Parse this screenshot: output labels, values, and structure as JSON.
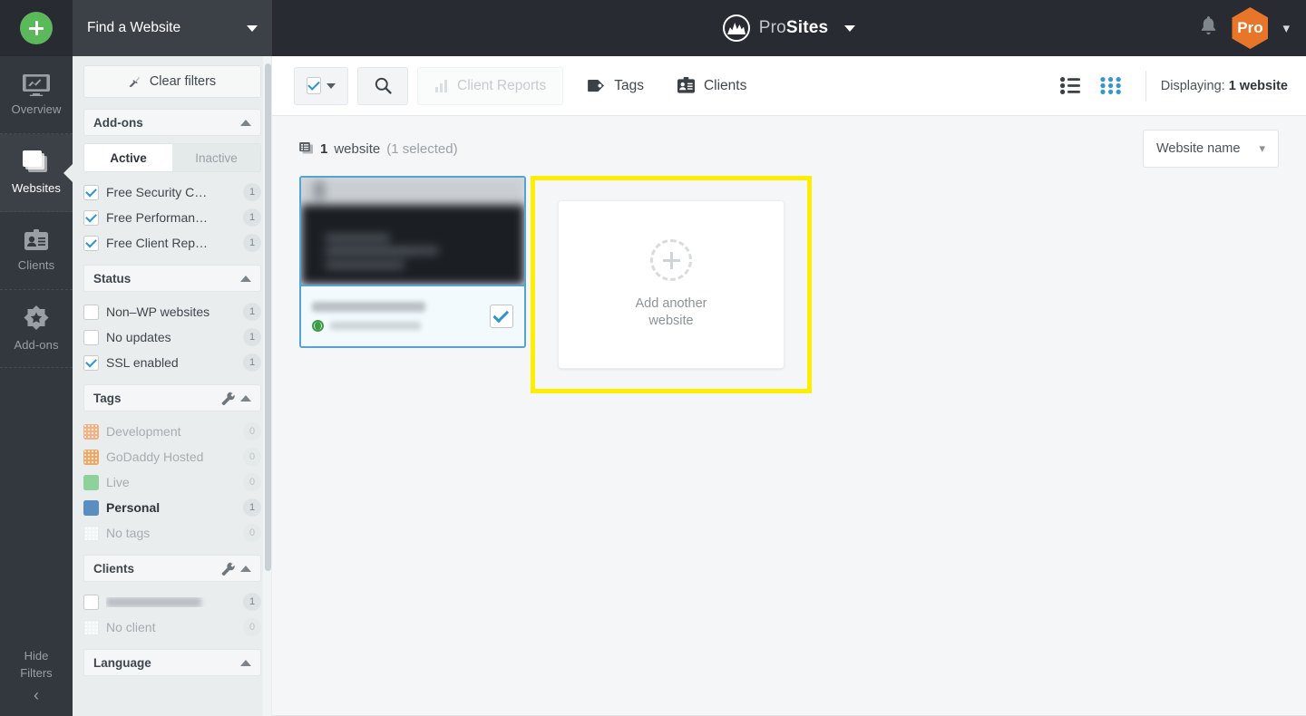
{
  "rail": {
    "add_button_tooltip": "+",
    "items": [
      {
        "label": "Overview",
        "icon": "monitor-chart-icon",
        "active": false
      },
      {
        "label": "Websites",
        "icon": "websites-stack-icon",
        "active": true
      },
      {
        "label": "Clients",
        "icon": "client-badge-icon",
        "active": false
      },
      {
        "label": "Add-ons",
        "icon": "addons-star-icon",
        "active": false
      }
    ],
    "hide_filters_line1": "Hide",
    "hide_filters_line2": "Filters",
    "hide_filters_chevron": "‹"
  },
  "filters": {
    "header_title": "Find a Website",
    "clear_filters_label": "Clear filters",
    "sections": [
      {
        "title": "Add-ons",
        "toggle": {
          "active_label": "Active",
          "inactive_label": "Inactive",
          "selected": "Active"
        },
        "items": [
          {
            "label": "Free Security C…",
            "count": "1",
            "checked": true
          },
          {
            "label": "Free Performan…",
            "count": "1",
            "checked": true
          },
          {
            "label": "Free Client Rep…",
            "count": "1",
            "checked": true
          }
        ]
      },
      {
        "title": "Status",
        "items": [
          {
            "label": "Non–WP websites",
            "count": "1",
            "checked": false
          },
          {
            "label": "No updates",
            "count": "1",
            "checked": false
          },
          {
            "label": "SSL enabled",
            "count": "1",
            "checked": true
          }
        ]
      },
      {
        "title": "Tags",
        "has_tool": true,
        "items": [
          {
            "label": "Development",
            "count": "0",
            "color": "#f3b183",
            "dotted": true,
            "dim": true
          },
          {
            "label": "GoDaddy Hosted",
            "count": "0",
            "color": "#f0a766",
            "dotted": true,
            "dim": true
          },
          {
            "label": "Live",
            "count": "0",
            "color": "#8ed19a",
            "dim": true
          },
          {
            "label": "Personal",
            "count": "1",
            "color": "#5a8ec0",
            "dim": false
          },
          {
            "label": "No tags",
            "count": "0",
            "color": "#f2f5f6",
            "dotted": true,
            "dim": true
          }
        ]
      },
      {
        "title": "Clients",
        "has_tool": true,
        "items": [
          {
            "label": "",
            "redacted": true,
            "count": "1",
            "checked": false
          },
          {
            "label": "No client",
            "count": "0",
            "dim": true
          }
        ]
      },
      {
        "title": "Language",
        "items": []
      }
    ]
  },
  "topbar": {
    "brand_part1": "Pro",
    "brand_part2": "Sites",
    "logo_icon": "mountain-logo-icon",
    "brand_caret_icon": "caret-down-icon",
    "bell_icon": "notification-bell-icon",
    "avatar_label": "Pro",
    "avatar_caret_icon": "chevron-down-icon"
  },
  "toolbar": {
    "select_all_icon": "checkbox-checked-icon",
    "select_all_caret_icon": "caret-down-icon",
    "search_icon": "search-icon",
    "client_reports_label": "Client Reports",
    "client_reports_icon": "report-chart-icon",
    "client_reports_disabled": true,
    "tags_label": "Tags",
    "tags_icon": "tag-icon",
    "clients_label": "Clients",
    "clients_icon": "client-badge-icon",
    "list_view_icon": "list-view-icon",
    "grid_view_icon": "grid-view-icon",
    "active_view": "grid",
    "displaying_prefix": "Displaying:",
    "displaying_value": "1 website"
  },
  "content": {
    "count_icon": "websites-stack-icon",
    "count_number": "1",
    "count_unit": "website",
    "count_selected": "(1 selected)",
    "sort_value": "Website name",
    "sort_caret_icon": "chevron-down-icon",
    "site_card": {
      "name_redacted": true,
      "url_redacted": true,
      "status_icon": "globe-icon",
      "selected": true,
      "checkbox_icon": "checkbox-checked-icon"
    },
    "add_card": {
      "plus_icon": "dashed-plus-icon",
      "label_line1": "Add another",
      "label_line2": "website"
    },
    "highlight_color": "#ffee00"
  },
  "colors": {
    "rail_bg": "#33383e",
    "topbar_bg": "#282c32",
    "filter_bg": "#e9edee",
    "accent_blue": "#2d93d2",
    "accent_green": "#5bb85b",
    "accent_orange": "#e8762a",
    "highlight_yellow": "#ffee00",
    "card_border": "#55a3d2"
  }
}
